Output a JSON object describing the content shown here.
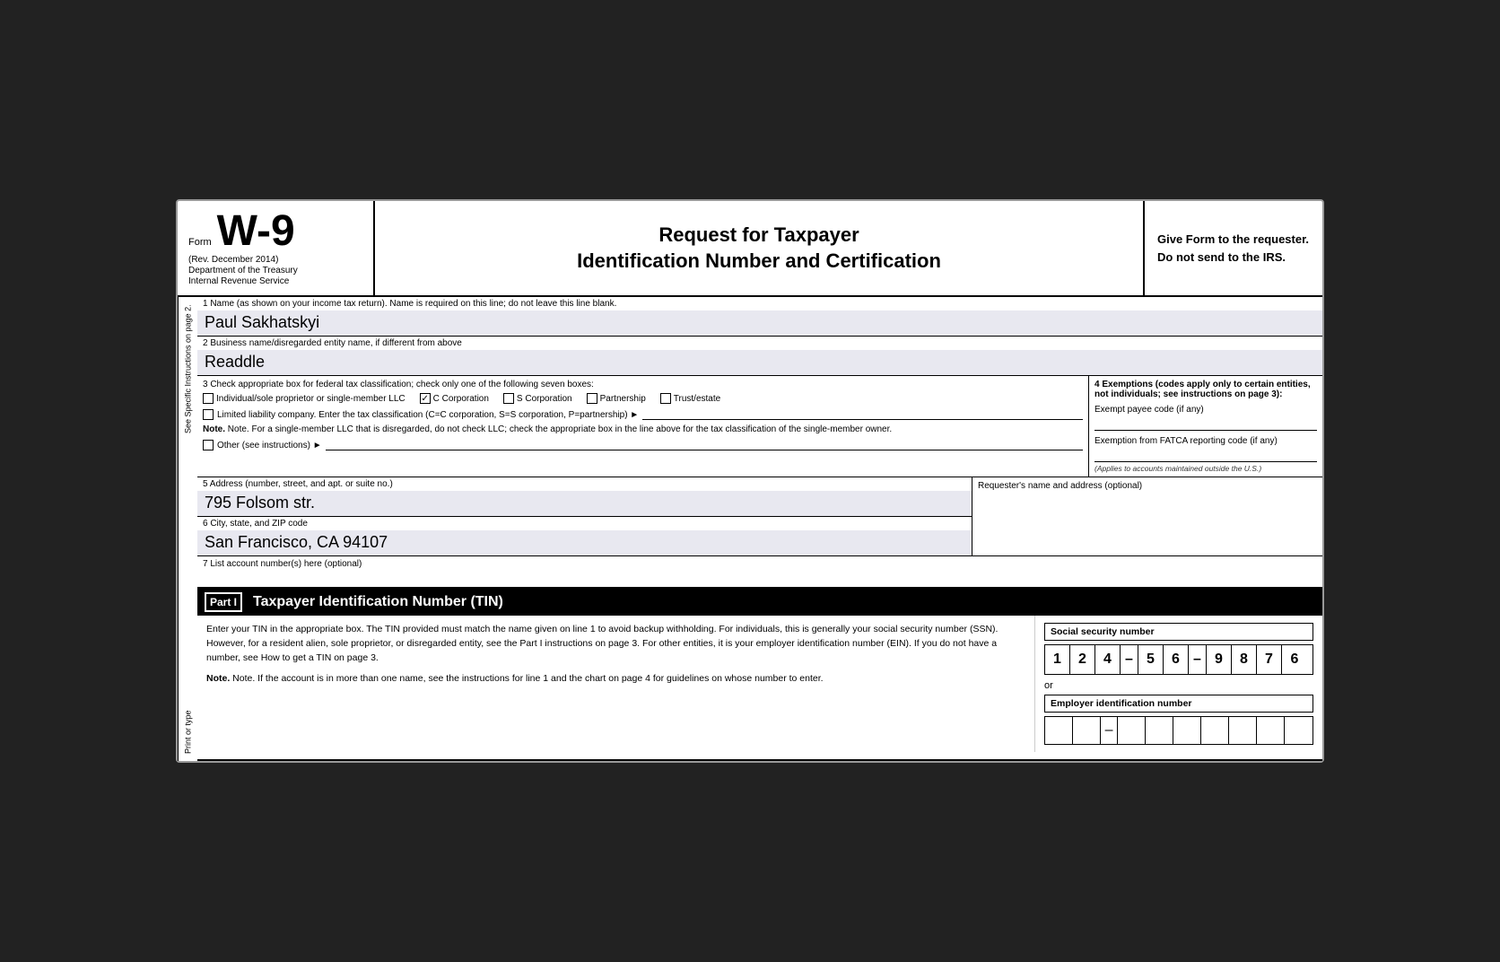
{
  "header": {
    "form_label": "Form",
    "form_number": "W-9",
    "rev": "(Rev. December 2014)",
    "dept": "Department of the Treasury",
    "irs": "Internal Revenue Service",
    "title_line1": "Request for Taxpayer",
    "title_line2": "Identification Number and Certification",
    "give_form": "Give Form to the requester. Do not send to the IRS."
  },
  "sidebar": {
    "line1": "Print or type",
    "line2": "See Specific Instructions on page 2."
  },
  "fields": {
    "field1_label": "1  Name (as shown on your income tax return). Name is required on this line; do not leave this line blank.",
    "field1_value": "Paul Sakhatskyi",
    "field2_label": "2  Business name/disregarded entity name, if different from above",
    "field2_value": "Readdle",
    "field3_label": "3  Check appropriate box for federal tax classification; check only one of the following seven boxes:",
    "checkbox_individual": "Individual/sole proprietor or single-member LLC",
    "checkbox_c_corp": "C Corporation",
    "checkbox_s_corp": "S Corporation",
    "checkbox_partnership": "Partnership",
    "checkbox_trust": "Trust/estate",
    "checkbox_llc_text": "Limited liability company. Enter the tax classification (C=C corporation, S=S corporation, P=partnership) ►",
    "note_text": "Note. For a single-member LLC that is disregarded, do not check LLC; check the appropriate box in the line above for the tax classification of the single-member owner.",
    "checkbox_other": "Other (see instructions) ►",
    "field4_label": "4  Exemptions (codes apply only to certain entities, not individuals; see instructions on page 3):",
    "exempt_payee": "Exempt payee code (if any)",
    "fatca_label": "Exemption from FATCA reporting code (if any)",
    "fatca_note": "(Applies to accounts maintained outside the U.S.)",
    "field5_label": "5  Address (number, street, and apt. or suite no.)",
    "field5_value": "795 Folsom str.",
    "requester_label": "Requester's name and address (optional)",
    "field6_label": "6  City, state, and ZIP code",
    "field6_value": "San Francisco, CA 94107",
    "field7_label": "7  List account number(s) here (optional)"
  },
  "part1": {
    "label": "Part I",
    "title": "Taxpayer Identification Number (TIN)",
    "body_text": "Enter your TIN in the appropriate box. The TIN provided must match the name given on line 1 to avoid backup withholding. For individuals, this is generally your social security number (SSN). However, for a resident alien, sole proprietor, or disregarded entity, see the Part I instructions on page 3. For other entities, it is your employer identification number (EIN). If you do not have a number, see How to get a TIN on page 3.",
    "note_text": "Note. If the account is in more than one name, see the instructions for line 1 and the chart on page 4 for guidelines on whose number to enter.",
    "ssn_label": "Social security number",
    "ssn_digits": [
      "1",
      "2",
      "4",
      "5",
      "6",
      "9",
      "8",
      "7",
      "6"
    ],
    "or_text": "or",
    "ein_label": "Employer identification number"
  }
}
